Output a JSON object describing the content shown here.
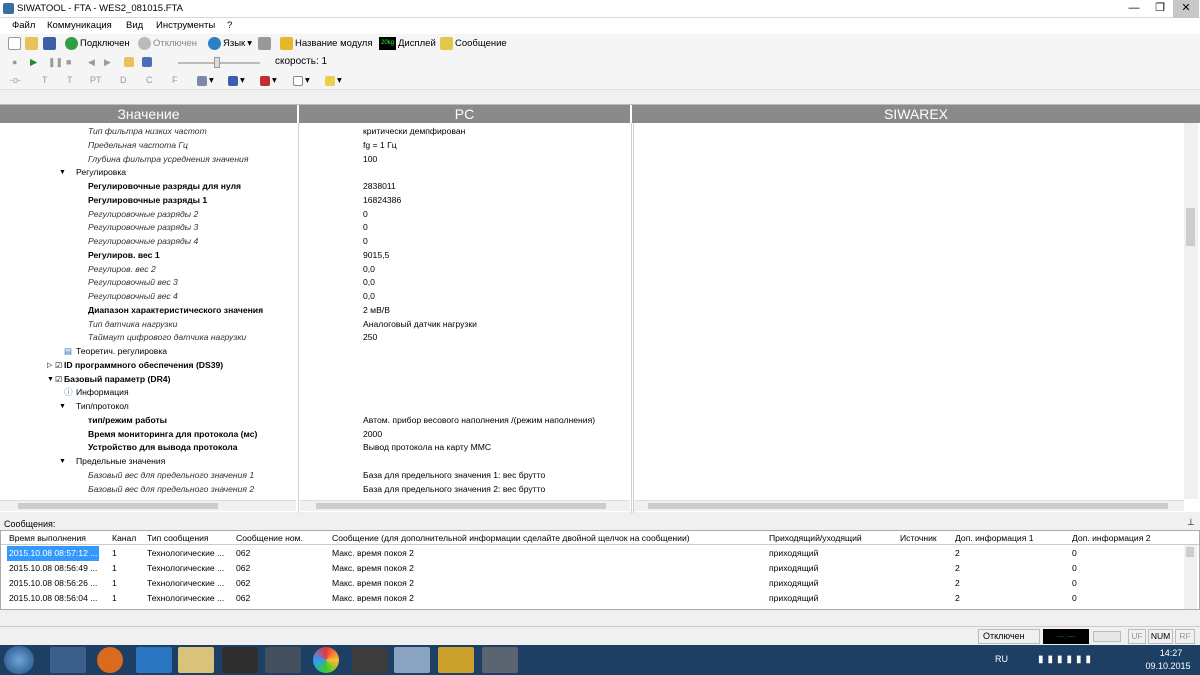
{
  "window": {
    "title": "SIWATOOL - FTA - WES2_081015.FTA"
  },
  "menu": [
    "Файл",
    "Коммуникация",
    "Вид",
    "Инструменты",
    "?"
  ],
  "toolbar": {
    "connected": "Подключен",
    "disconnected": "Отключен",
    "language": "Язык",
    "module_name": "Название модуля",
    "display": "Дисплей",
    "message": "Сообщение",
    "speed_label": "скорость: 1",
    "display_icon_text": "20kg"
  },
  "toolbar3": {
    "t": "T",
    "t2": "T",
    "pt": "PT",
    "d": "D",
    "c": "C",
    "f": "F"
  },
  "columns": {
    "value": "Значение",
    "pc": "PC",
    "siwarex": "SIWAREX"
  },
  "rows": [
    {
      "name": "Тип фильтра низких частот",
      "value": "критически демпфирован",
      "style": "i",
      "indent": 88
    },
    {
      "name": "Предельная частота Гц",
      "value": "fg = 1 Гц",
      "style": "i",
      "indent": 88
    },
    {
      "name": "Глубина фильтра усреднения значения",
      "value": "100",
      "style": "i",
      "indent": 88
    },
    {
      "name": "Регулировка",
      "value": "",
      "style": "g",
      "indent": 76,
      "expander": "▼"
    },
    {
      "name": "Регулировочные разряды для нуля",
      "value": "2838011",
      "style": "b",
      "indent": 88
    },
    {
      "name": "Регулировочные разряды 1",
      "value": "16824386",
      "style": "b",
      "indent": 88
    },
    {
      "name": "Регулировочные разряды 2",
      "value": "0",
      "style": "i",
      "indent": 88
    },
    {
      "name": "Регулировочные разряды 3",
      "value": "0",
      "style": "i",
      "indent": 88
    },
    {
      "name": "Регулировочные разряды 4",
      "value": "0",
      "style": "i",
      "indent": 88
    },
    {
      "name": "Регулиров. вес 1",
      "value": "9015,5",
      "style": "b",
      "indent": 88
    },
    {
      "name": "Регулиров. вес 2",
      "value": "0,0",
      "style": "i",
      "indent": 88
    },
    {
      "name": "Регулировочный вес 3",
      "value": "0,0",
      "style": "i",
      "indent": 88
    },
    {
      "name": "Регулировочный вес 4",
      "value": "0,0",
      "style": "i",
      "indent": 88
    },
    {
      "name": "Диапазон характеристического значения",
      "value": "2 мВ/В",
      "style": "b",
      "indent": 88
    },
    {
      "name": "Тип датчика нагрузки",
      "value": "Аналоговый датчик нагрузки",
      "style": "i",
      "indent": 88
    },
    {
      "name": "Таймаут цифрового датчика нагрузки",
      "value": "250",
      "style": "i",
      "indent": 88
    },
    {
      "name": "Теоретич. регулировка",
      "value": "",
      "style": "g",
      "indent": 76,
      "icon": "table"
    },
    {
      "name": "ID программного обеспечения (DS39)",
      "value": "",
      "style": "b",
      "indent": 64,
      "expander": "▷",
      "check": true
    },
    {
      "name": "Базовый параметр (DR4)",
      "value": "",
      "style": "b",
      "indent": 64,
      "expander": "▼",
      "check": true
    },
    {
      "name": "Информация",
      "value": "",
      "style": "g",
      "indent": 76,
      "icon": "info"
    },
    {
      "name": "Тип/протокол",
      "value": "",
      "style": "g",
      "indent": 76,
      "expander": "▼"
    },
    {
      "name": "тип/режим работы",
      "value": "Автом. прибор весового наполнения /(режим наполнения)",
      "style": "b",
      "indent": 88
    },
    {
      "name": "Время мониторинга для протокола (мс)",
      "value": "2000",
      "style": "b",
      "indent": 88
    },
    {
      "name": "Устройство для вывода протокола",
      "value": "Вывод протокола на карту MMC",
      "style": "b",
      "indent": 88
    },
    {
      "name": "Предельные значения",
      "value": "",
      "style": "g",
      "indent": 76,
      "expander": "▼"
    },
    {
      "name": "Базовый вес для предельного значения 1",
      "value": "База для предельного значения 1: вес брутто",
      "style": "i",
      "indent": 88
    },
    {
      "name": "Базовый вес для предельного значения 2",
      "value": "База для предельного значения 2: вес брутто",
      "style": "i",
      "indent": 88
    }
  ],
  "messages": {
    "label": "Сообщения:",
    "headers": [
      "Время выполнения",
      "Канал",
      "Тип сообщения",
      "Сообщение ном.",
      "Сообщение (для дополнительной информации сделайте двойной щелчок на сообщении)",
      "Приходящий/уходящий",
      "Источник",
      "Доп. информация 1",
      "Доп. информация 2"
    ],
    "rows": [
      [
        "2015.10.08 08:57:12 ...",
        "1",
        "Технологические ...",
        "062",
        "Макс. время покоя 2",
        "приходящий",
        "",
        "2",
        "0"
      ],
      [
        "2015.10.08 08:56:49 ...",
        "1",
        "Технологические ...",
        "062",
        "Макс. время покоя 2",
        "приходящий",
        "",
        "2",
        "0"
      ],
      [
        "2015.10.08 08:56:26 ...",
        "1",
        "Технологические ...",
        "062",
        "Макс. время покоя 2",
        "приходящий",
        "",
        "2",
        "0"
      ],
      [
        "2015.10.08 08:56:04 ...",
        "1",
        "Технологические ...",
        "062",
        "Макс. время покоя 2",
        "приходящий",
        "",
        "2",
        "0"
      ]
    ]
  },
  "status": {
    "conn": "Отключен",
    "display": "---.---",
    "uf": "UF",
    "num": "NUM",
    "rf": "RF"
  },
  "taskbar": {
    "lang": "RU",
    "time": "14:27",
    "date": "09.10.2015"
  }
}
